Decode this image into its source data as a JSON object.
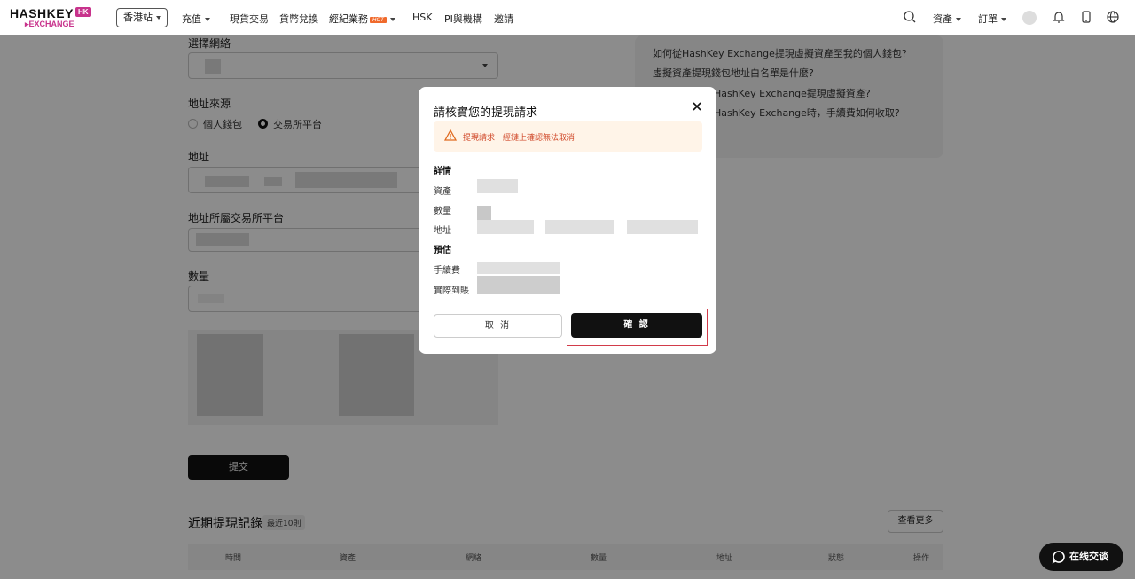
{
  "brand": {
    "name": "HASHKEY",
    "badge": "HK",
    "sub": "EXCHANGE"
  },
  "nav": {
    "region": "香港站",
    "items": [
      "充值",
      "現貨交易",
      "貨幣兌換",
      "經紀業務",
      "HSK",
      "PI與機構",
      "邀請"
    ],
    "hot_badge": "HOT",
    "right": {
      "assets": "資產",
      "orders": "訂單"
    }
  },
  "form": {
    "network_label": "選擇網絡",
    "source_label": "地址來源",
    "source_options": [
      "個人錢包",
      "交易所平台"
    ],
    "source_selected": "交易所平台",
    "address_label": "地址",
    "platform_label": "地址所屬交易所平台",
    "amount_label": "數量",
    "submit_label": "提交"
  },
  "faq": {
    "items": [
      "如何從HashKey Exchange提現虛擬資產至我的個人錢包?",
      "虛擬資產提現錢包地址白名單是什麼?",
      "HashKey Exchange提現虛擬資產?",
      "HashKey Exchange時，手續費如何收取?"
    ]
  },
  "history": {
    "title": "近期提現記錄",
    "badge": "最近10則",
    "more_label": "查看更多",
    "columns": [
      "時間",
      "資產",
      "網絡",
      "數量",
      "地址",
      "狀態",
      "操作"
    ]
  },
  "chat": {
    "label": "在线交谈"
  },
  "modal": {
    "title": "請核實您的提現請求",
    "warning": "提現請求一經鏈上確認無法取消",
    "section_details": "詳情",
    "details": [
      "資產",
      "數量",
      "地址"
    ],
    "section_estimate": "預估",
    "estimates": [
      "手續費",
      "實際到賬"
    ],
    "cancel_label": "取 消",
    "confirm_label": "確 認"
  }
}
